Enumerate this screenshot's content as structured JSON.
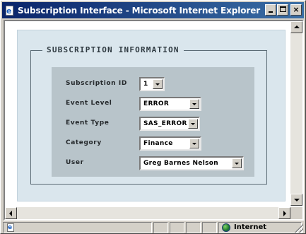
{
  "window": {
    "title": "Subscription Interface - Microsoft Internet Explorer",
    "minimize_label": "",
    "maximize_label": "",
    "close_label": "×"
  },
  "form": {
    "legend": "SUBSCRIPTION INFORMATION",
    "fields": [
      {
        "label": "Subscription ID",
        "value": "1"
      },
      {
        "label": "Event Level",
        "value": "ERROR"
      },
      {
        "label": "Event Type",
        "value": "SAS_ERROR"
      },
      {
        "label": "Category",
        "value": "Finance"
      },
      {
        "label": "User",
        "value": "Greg Barnes Nelson"
      }
    ]
  },
  "statusbar": {
    "zone": "Internet"
  },
  "icons": {
    "app": "ie-page-icon",
    "zone": "globe-icon"
  },
  "colors": {
    "titlebar": "#0a246a",
    "page_panel": "#dae6ed",
    "form_panel": "#b8c4ca"
  }
}
